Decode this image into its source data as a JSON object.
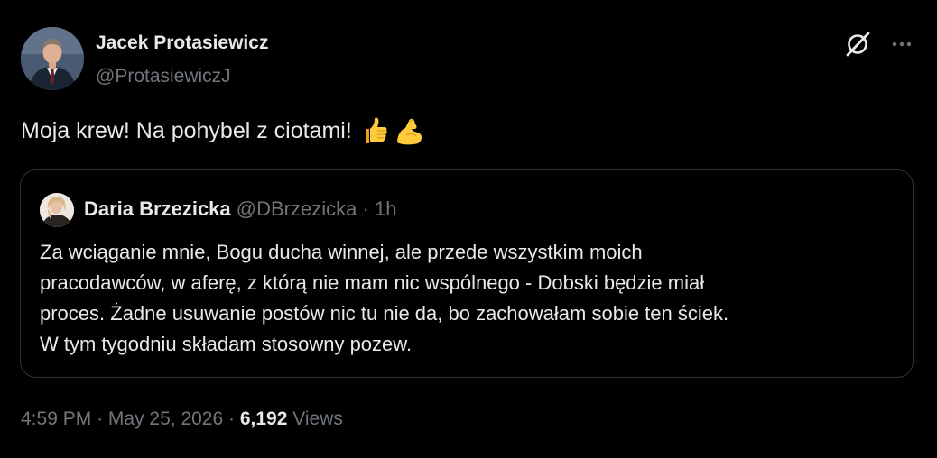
{
  "author": {
    "name": "Jacek Protasiewicz",
    "handle": "@ProtasiewiczJ"
  },
  "header_icons": {
    "grok": "grok-icon",
    "more": "more-icon"
  },
  "tweet": {
    "text": "Moja krew! Na pohybel z ciotami!",
    "emojis": [
      "thumbs-up-emoji",
      "flexed-biceps-emoji"
    ]
  },
  "quote": {
    "name": "Daria Brzezicka",
    "handle": "@DBrzezicka",
    "separator": "·",
    "time": "1h",
    "lines": [
      "Za wciąganie mnie, Bogu ducha winnej,  ale przede wszystkim moich",
      "pracodawców, w aferę, z którą nie mam nic wspólnego - Dobski będzie miał",
      "proces. Żadne usuwanie postów nic tu nie da, bo zachowałam sobie ten ściek.",
      "W tym tygodniu składam stosowny pozew."
    ]
  },
  "meta": {
    "time": "4:59 PM",
    "separator": "·",
    "date": "May 25, 2026",
    "views_count": "6,192",
    "views_label": "Views"
  },
  "colors": {
    "background": "#000000",
    "text_primary": "#e7e9ea",
    "text_secondary": "#71767b",
    "border": "#2f3336"
  }
}
